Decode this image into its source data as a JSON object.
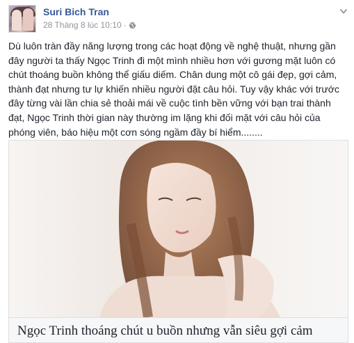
{
  "post": {
    "author": "Suri Bich Tran",
    "timestamp": "28 Tháng 8 lúc 10:10",
    "separator": "·",
    "privacy_icon": "globe-icon",
    "menu_icon": "chevron-down-icon",
    "body_lines": [
      "Dù luôn tràn đầy năng lượng trong các hoạt động về nghệ thuật, nhưng gần",
      "đây người ta thấy Ngọc Trinh đi một mình nhiều hơn với gương mặt luôn có",
      "chút thoáng buồn không thể giấu diếm. Chân dung một cô gái đẹp, gợi cảm,",
      "thành đạt nhưng tư lự khiến nhiều người đặt câu hỏi. Tuy vậy khác với trước",
      "đây từng vài lần chia sẻ thoải mái về cuộc tình bền vững với bạn trai thành",
      "đạt, Ngọc Trinh thời gian này thường im lặng khi đối mặt với câu hỏi của",
      "phóng viên, báo hiệu một cơn sóng ngầm đầy bí hiểm........"
    ]
  },
  "link_card": {
    "title": "Ngọc Trinh thoáng chút u buồn nhưng vẫn siêu gợi cảm"
  },
  "colors": {
    "author": "#365899",
    "meta": "#90949c",
    "text": "#1d2129",
    "border": "#dddfe2",
    "caption_bg": "#f6f7f9"
  }
}
